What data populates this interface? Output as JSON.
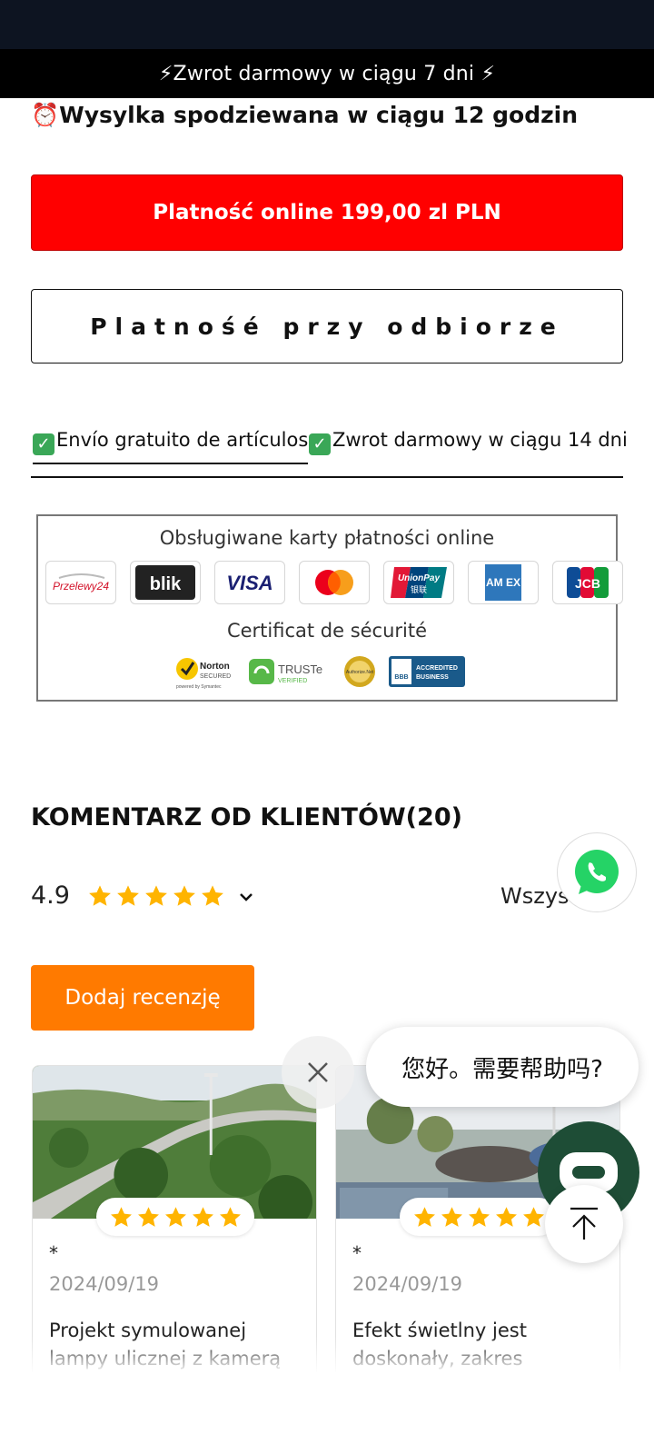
{
  "announcement": "⚡Zwrot darmowy w ciągu 7 dni ⚡",
  "shipping": {
    "icon": "alarm-clock-icon",
    "text": "⏰Wysylka spodziewana w ciągu 12 godzin"
  },
  "buttons": {
    "pay_online": "Platność online 199,00 zl PLN",
    "pay_on_delivery": "Platnośé przy odbiorze"
  },
  "tabs": [
    {
      "label": "Envío gratuito de artículos",
      "active": true
    },
    {
      "label": "Zwrot darmowy w ciągu 14 dni",
      "active": false
    }
  ],
  "payment_box": {
    "title": "Obsługiwane karty płatności online",
    "cards": [
      "Przelewy24",
      "blik",
      "VISA",
      "mastercard",
      "UnionPay",
      "AMEX",
      "JCB"
    ],
    "card_texts": {
      "przelewy": "Przelewy24",
      "blik": "blik",
      "visa": "VISA",
      "unionpay": "UnionPay",
      "unionpay_cn": "银联",
      "amex": "AM EX",
      "jcb": "JCB"
    },
    "cert_title": "Certificat de sécurité",
    "cert_texts": {
      "norton_name": "Norton",
      "norton_sub": "SECURED",
      "norton_by": "powered by Symantec",
      "truste_name": "TRUSTe",
      "truste_sub": "VERIFIED",
      "authorize": "Authorize.Net",
      "bbb": "BBB",
      "bbb_line1": "ACCREDITED",
      "bbb_line2": "BUSINESS"
    }
  },
  "reviews": {
    "heading": "KOMENTARZ OD KLIENTÓW(20)",
    "average": "4.9",
    "stars": 5,
    "filter_label": "Wszystkie",
    "add_button": "Dodaj recenzję",
    "items": [
      {
        "author": "*",
        "date": "2024/09/19",
        "text": "Projekt symulowanej lampy ulicznej z kamerą nadaje się do ogrodu",
        "stars": 5
      },
      {
        "author": "*",
        "date": "2024/09/19",
        "text": "Efekt świetlny jest doskonały, zakres oświetlenia jest duży",
        "stars": 5
      }
    ]
  },
  "chat": {
    "greeting": "您好。需要帮助吗?"
  },
  "colors": {
    "status_bar": "#0d1421",
    "announcement_bg": "#000000",
    "pay_online": "#ff0000",
    "add_review": "#ff7a00",
    "star": "#ffb400",
    "chat_launcher": "#1e4d36",
    "whatsapp": "#25d366"
  }
}
